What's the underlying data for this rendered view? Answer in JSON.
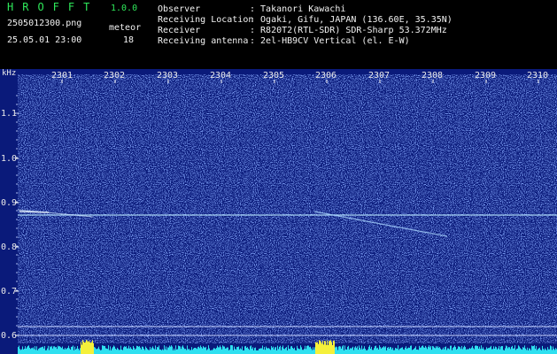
{
  "app": {
    "title": "HROFFT",
    "version": "1.0.0"
  },
  "file_name": "2505012300.png",
  "datetime": "25.05.01 23:00",
  "meteor": {
    "label": "meteor",
    "count": "18"
  },
  "info": [
    {
      "label": "Observer",
      "value": ": Takanori Kawachi"
    },
    {
      "label": "Receiving Location",
      "value": ": Ogaki, Gifu, JAPAN (136.60E, 35.35N)"
    },
    {
      "label": "Receiver",
      "value": ": R820T2(RTL-SDR) SDR-Sharp 53.372MHz"
    },
    {
      "label": "Receiving antenna",
      "value": ": 2el-HB9CV Vertical (el. E-W)"
    }
  ],
  "spectrogram": {
    "unit_label": "kHz",
    "time_ticks": [
      "2301",
      "2302",
      "2303",
      "2304",
      "2305",
      "2306",
      "2307",
      "2308",
      "2309",
      "2310"
    ],
    "freq_ticks": [
      "1.1",
      "1.0",
      "0.9",
      "0.8",
      "0.7",
      "0.6"
    ],
    "colors": {
      "background": "#0a1a7a",
      "noise": "#3a5fe0",
      "signal": "#c8e8ff",
      "meter": "#2fe0f0",
      "peak": "#f5f03a"
    }
  }
}
